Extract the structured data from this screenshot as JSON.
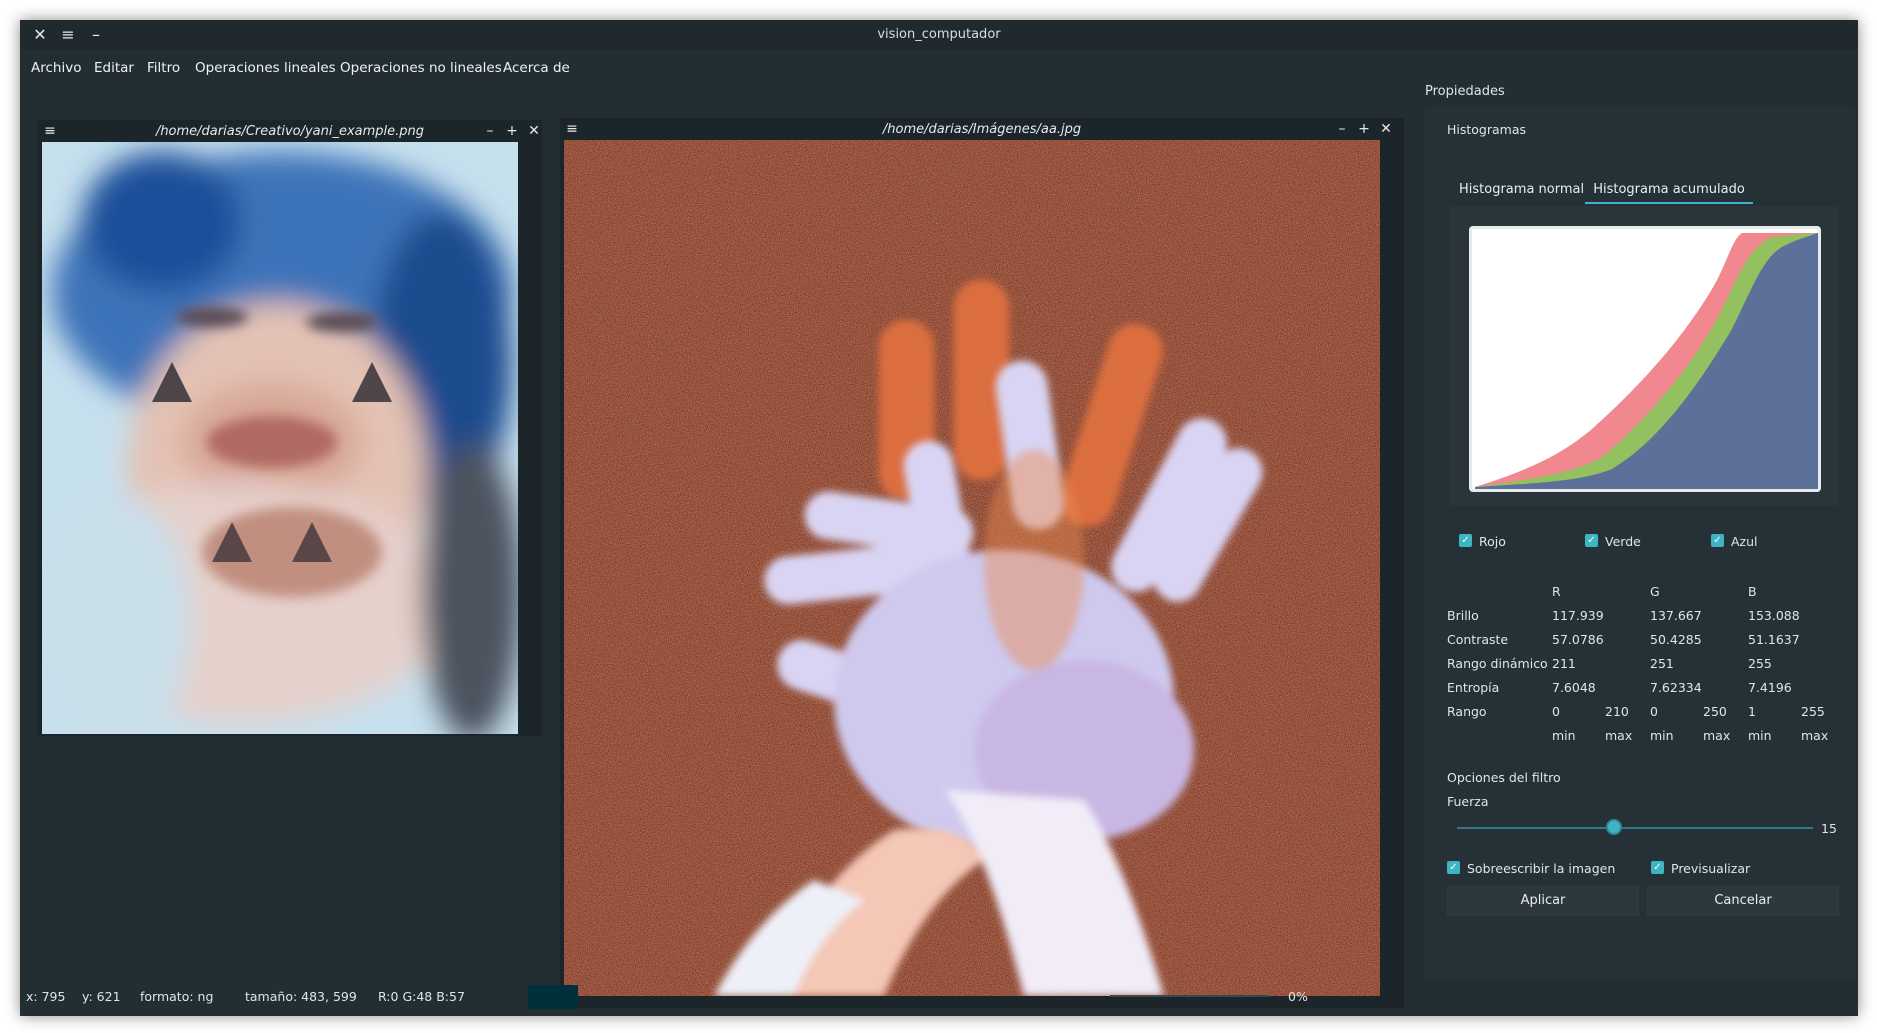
{
  "window": {
    "title": "vision_computador"
  },
  "menu": [
    "Archivo",
    "Editar",
    "Filtro",
    "Operaciones lineales",
    "Operaciones no lineales",
    "Acerca de"
  ],
  "subwindows": {
    "left": {
      "title": "/home/darias/Creativo/yani_example.png"
    },
    "right": {
      "title": "/home/darias/Imágenes/aa.jpg"
    }
  },
  "status": {
    "x": "x: 795",
    "y": "y: 621",
    "format": "formato: ng",
    "size": "tamaño: 483, 599",
    "rgb": "R:0  G:48  B:57",
    "progress": "0%",
    "progress_value": 0,
    "swatch_color": "#003039"
  },
  "panel": {
    "title": "Propiedades",
    "histograms_label": "Histogramas",
    "tabs": [
      "Histograma normal",
      "Histograma acumulado"
    ],
    "active_tab": 1,
    "channels": [
      "Rojo",
      "Verde",
      "Azul"
    ],
    "channel_colors": {
      "red": "#f2888f",
      "green": "#93c15f",
      "blue": "#5d7099"
    },
    "stats_headers": [
      "R",
      "G",
      "B"
    ],
    "stats": [
      {
        "label": "Brillo",
        "values": [
          "117.939",
          "137.667",
          "153.088"
        ]
      },
      {
        "label": "Contraste",
        "values": [
          "57.0786",
          "50.4285",
          "51.1637"
        ]
      },
      {
        "label": "Rango dinámico",
        "values": [
          "211",
          "251",
          "255"
        ]
      },
      {
        "label": "Entropía",
        "values": [
          "7.6048",
          "7.62334",
          "7.4196"
        ]
      }
    ],
    "range": {
      "label": "Rango",
      "values": [
        "0",
        "210",
        "0",
        "250",
        "1",
        "255"
      ],
      "sublabels": [
        "min",
        "max",
        "min",
        "max",
        "min",
        "max"
      ]
    },
    "filter": {
      "title": "Opciones del filtro",
      "strength_label": "Fuerza",
      "strength_value": "15",
      "strength_fraction": 0.44,
      "overwrite_label": "Sobreescribir la imagen",
      "preview_label": "Previsualizar",
      "apply_label": "Aplicar",
      "cancel_label": "Cancelar"
    },
    "accent_color": "#3fb4c4"
  }
}
